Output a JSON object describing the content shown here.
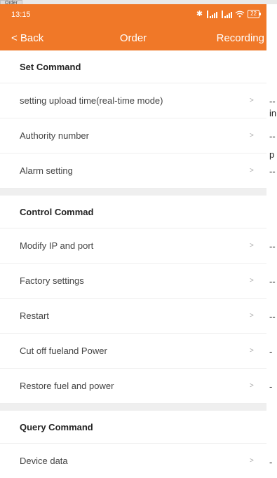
{
  "window": {
    "tab_title": "Order"
  },
  "status_bar": {
    "time": "13:15",
    "battery": "22",
    "icons": [
      "bluetooth-icon",
      "signal-icon",
      "signal-icon",
      "wifi-icon",
      "battery-icon"
    ]
  },
  "header": {
    "back_label": "< Back",
    "title": "Order",
    "right_label": "Recording"
  },
  "sections": [
    {
      "title": "Set Command",
      "items": [
        {
          "label": "setting upload time(real-time mode)",
          "chevron": ">"
        },
        {
          "label": "Authority number",
          "chevron": ">"
        },
        {
          "label": "Alarm setting",
          "chevron": ">"
        }
      ]
    },
    {
      "title": "Control Commad",
      "items": [
        {
          "label": "Modify IP and port",
          "chevron": ">"
        },
        {
          "label": "Factory settings",
          "chevron": ">"
        },
        {
          "label": "Restart",
          "chevron": ">"
        },
        {
          "label": "Cut off fueland Power",
          "chevron": ">"
        },
        {
          "label": "Restore fuel and power",
          "chevron": ">"
        }
      ]
    },
    {
      "title": "Query Command",
      "items": [
        {
          "label": "Device data",
          "chevron": ">"
        }
      ]
    }
  ],
  "overflow_text": [
    "--",
    "in",
    "--",
    "p",
    "--",
    "--",
    "--",
    "--",
    "-",
    "-",
    "-"
  ],
  "colors": {
    "header_bg": "#f07828",
    "divider": "#eeeeee",
    "section_gap": "#efefef"
  }
}
